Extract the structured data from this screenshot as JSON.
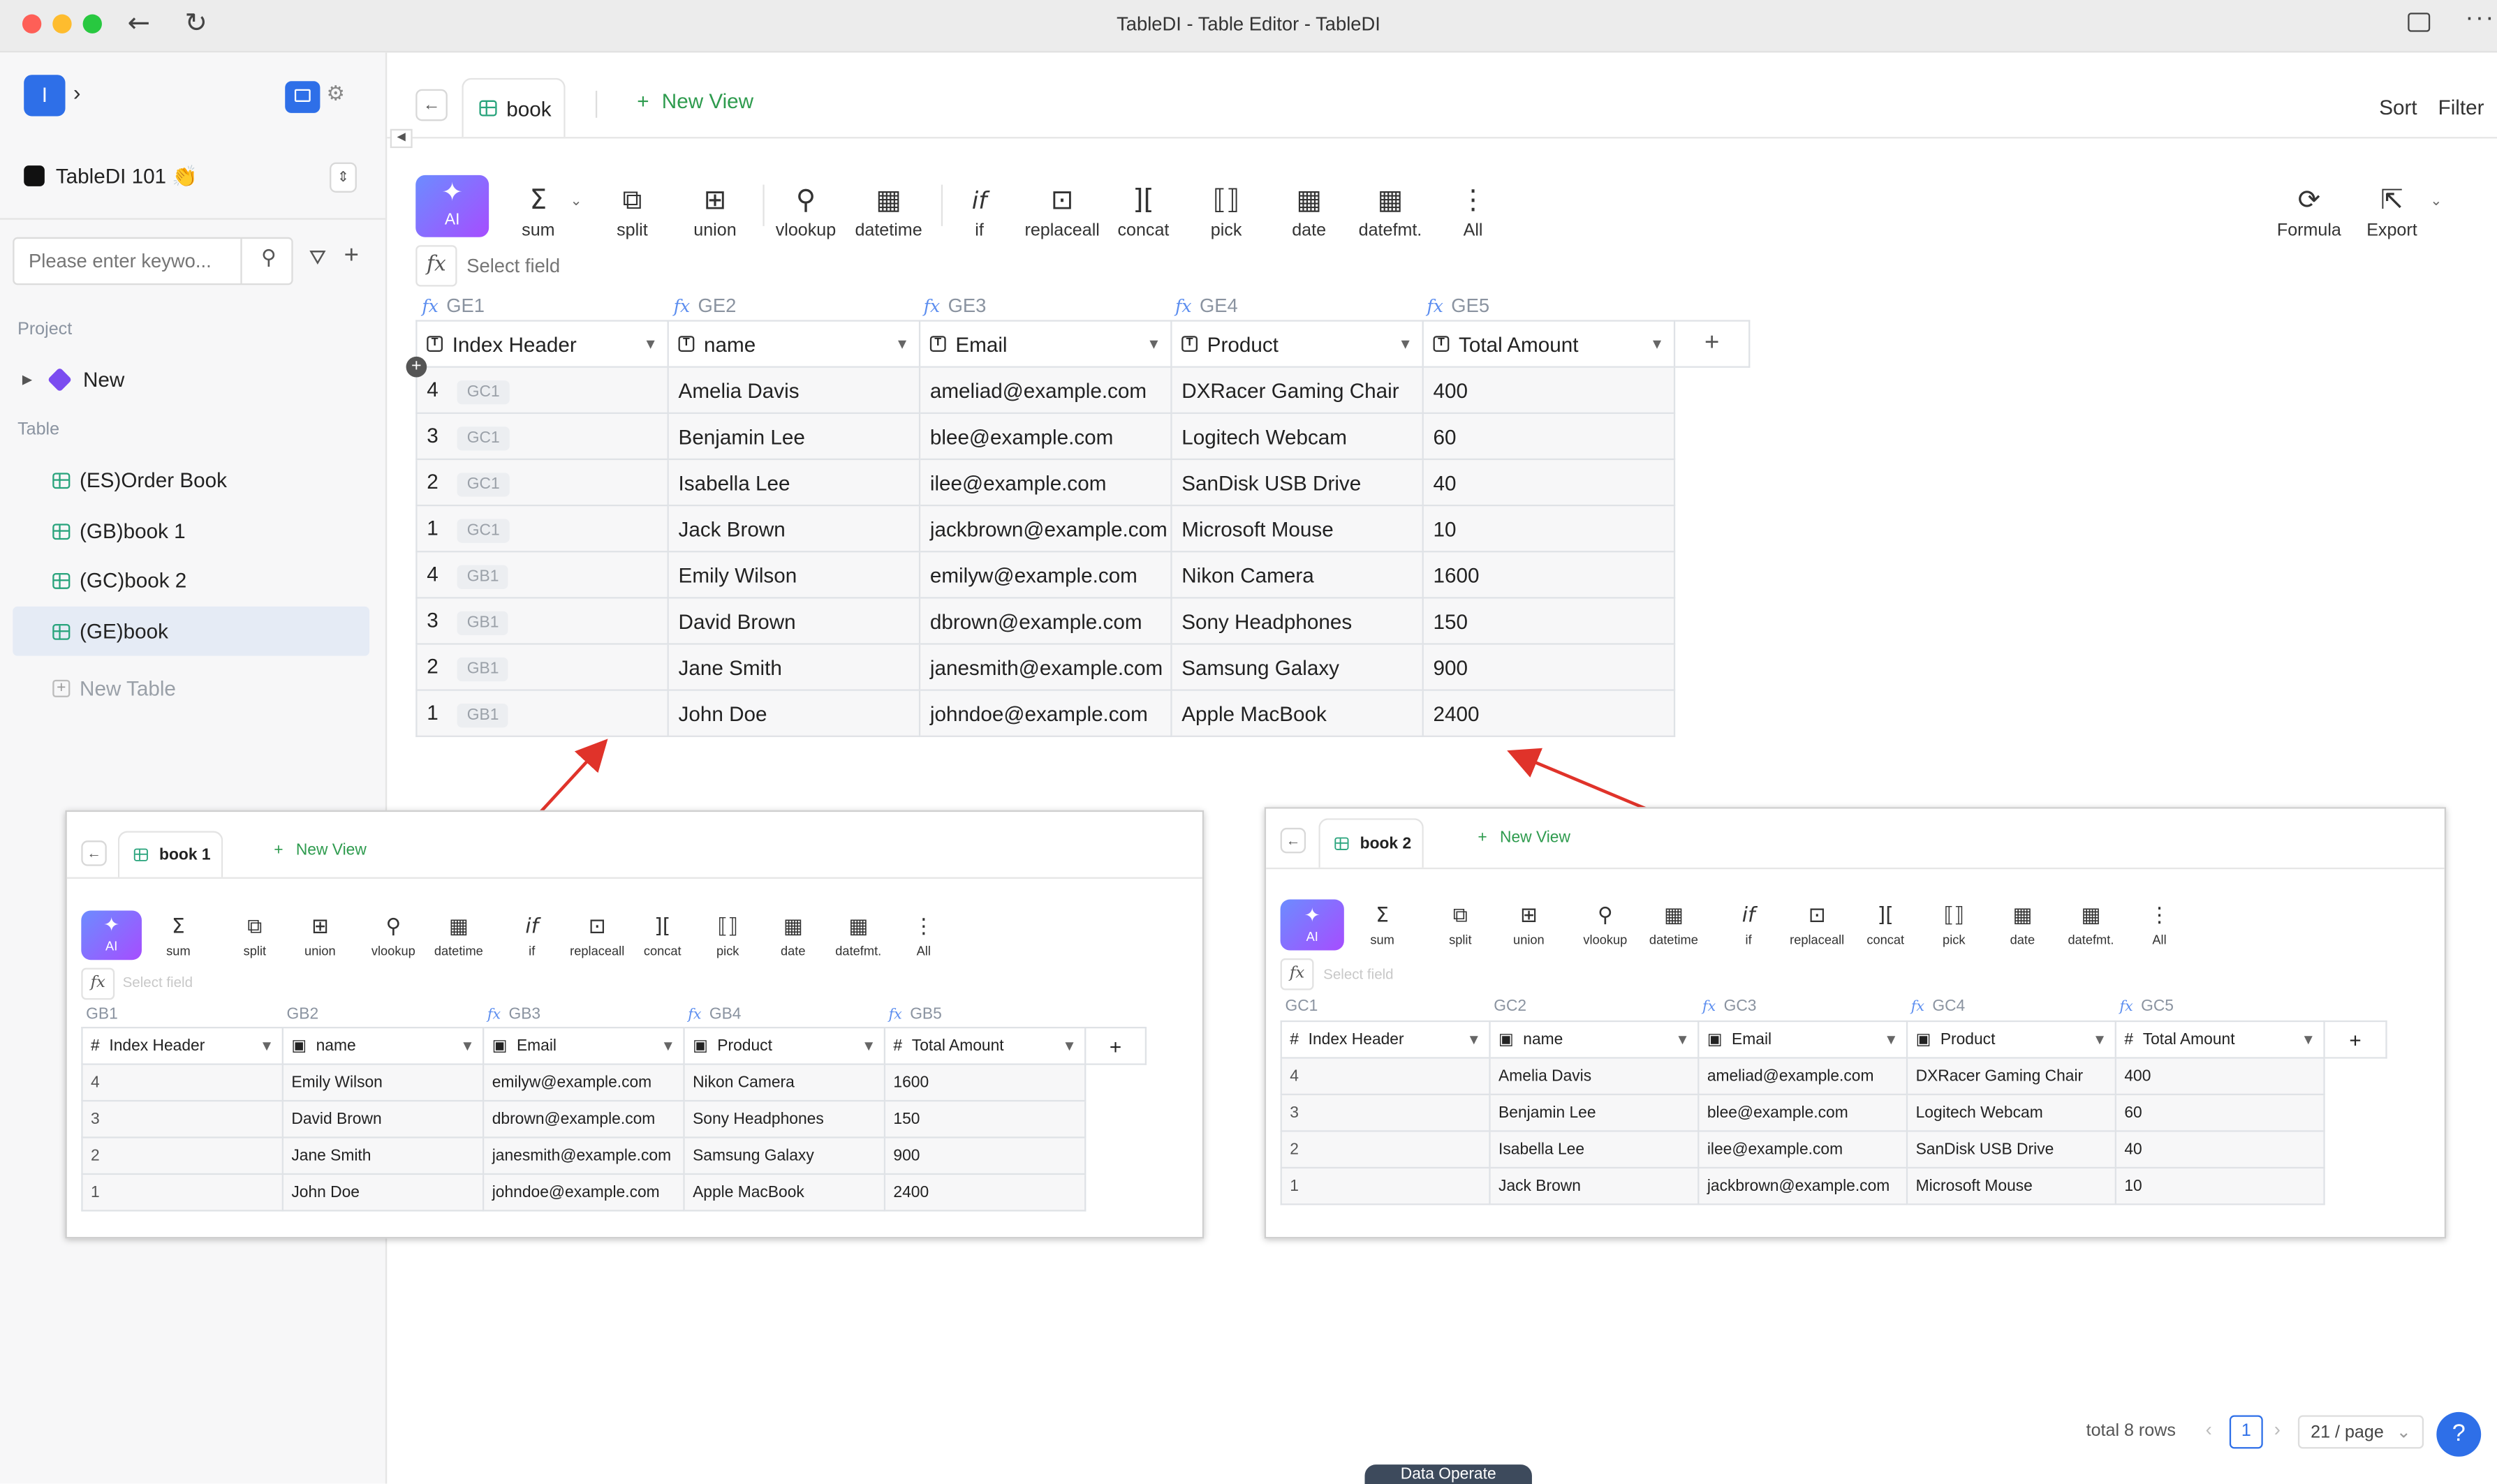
{
  "window": {
    "title": "TableDI - Table Editor - TableDI"
  },
  "workspace": {
    "avatar_letter": "I",
    "name": "TableDI 101 👏"
  },
  "search": {
    "placeholder": "Please enter keywo..."
  },
  "sidebar": {
    "project_label": "Project",
    "project_item": "New",
    "table_label": "Table",
    "tables": [
      "(ES)Order Book",
      "(GB)book 1",
      "(GC)book 2",
      "(GE)book"
    ],
    "new_table": "New Table"
  },
  "tab": {
    "label": "book"
  },
  "new_view": "New View",
  "sort": "Sort",
  "filter": "Filter",
  "toolbar": {
    "ai": "AI",
    "buttons": [
      "sum",
      "split",
      "union",
      "vlookup",
      "datetime",
      "if",
      "replaceall",
      "concat",
      "pick",
      "date",
      "datefmt.",
      "All"
    ],
    "formula": "Formula",
    "export": "Export",
    "select_field": "Select field"
  },
  "main_table": {
    "col_refs": [
      "GE1",
      "GE2",
      "GE3",
      "GE4",
      "GE5"
    ],
    "headers": [
      "Index Header",
      "name",
      "Email",
      "Product",
      "Total Amount"
    ],
    "rows": [
      {
        "idx": "4",
        "tag": "GC1",
        "name": "Amelia Davis",
        "email": "ameliad@example.com",
        "product": "DXRacer Gaming Chair",
        "amount": "400"
      },
      {
        "idx": "3",
        "tag": "GC1",
        "name": "Benjamin Lee",
        "email": "blee@example.com",
        "product": "Logitech Webcam",
        "amount": "60"
      },
      {
        "idx": "2",
        "tag": "GC1",
        "name": "Isabella Lee",
        "email": "ilee@example.com",
        "product": "SanDisk USB Drive",
        "amount": "40"
      },
      {
        "idx": "1",
        "tag": "GC1",
        "name": "Jack Brown",
        "email": "jackbrown@example.com",
        "product": "Microsoft Mouse",
        "amount": "10"
      },
      {
        "idx": "4",
        "tag": "GB1",
        "name": "Emily Wilson",
        "email": "emilyw@example.com",
        "product": "Nikon Camera",
        "amount": "1600"
      },
      {
        "idx": "3",
        "tag": "GB1",
        "name": "David Brown",
        "email": "dbrown@example.com",
        "product": "Sony Headphones",
        "amount": "150"
      },
      {
        "idx": "2",
        "tag": "GB1",
        "name": "Jane Smith",
        "email": "janesmith@example.com",
        "product": "Samsung Galaxy",
        "amount": "900"
      },
      {
        "idx": "1",
        "tag": "GB1",
        "name": "John Doe",
        "email": "johndoe@example.com",
        "product": "Apple MacBook",
        "amount": "2400"
      }
    ]
  },
  "book1": {
    "tab": "book 1",
    "col_refs": [
      "GB1",
      "GB2",
      "GB3",
      "GB4",
      "GB5"
    ],
    "headers": [
      "Index Header",
      "name",
      "Email",
      "Product",
      "Total Amount"
    ],
    "rows": [
      [
        "4",
        "Emily Wilson",
        "emilyw@example.com",
        "Nikon Camera",
        "1600"
      ],
      [
        "3",
        "David Brown",
        "dbrown@example.com",
        "Sony Headphones",
        "150"
      ],
      [
        "2",
        "Jane Smith",
        "janesmith@example.com",
        "Samsung Galaxy",
        "900"
      ],
      [
        "1",
        "John Doe",
        "johndoe@example.com",
        "Apple MacBook",
        "2400"
      ]
    ]
  },
  "book2": {
    "tab": "book 2",
    "col_refs": [
      "GC1",
      "GC2",
      "GC3",
      "GC4",
      "GC5"
    ],
    "headers": [
      "Index Header",
      "name",
      "Email",
      "Product",
      "Total Amount"
    ],
    "rows": [
      [
        "4",
        "Amelia Davis",
        "ameliad@example.com",
        "DXRacer Gaming Chair",
        "400"
      ],
      [
        "3",
        "Benjamin Lee",
        "blee@example.com",
        "Logitech Webcam",
        "60"
      ],
      [
        "2",
        "Isabella Lee",
        "ilee@example.com",
        "SanDisk USB Drive",
        "40"
      ],
      [
        "1",
        "Jack Brown",
        "jackbrown@example.com",
        "Microsoft Mouse",
        "10"
      ]
    ]
  },
  "footer": {
    "total": "total 8 rows",
    "page": "1",
    "per_page": "21 / page",
    "data_operate": "Data Operate"
  },
  "colors": {
    "accent": "#2e6fe8",
    "green": "#2e9b4e",
    "arrow": "#e0332a"
  }
}
